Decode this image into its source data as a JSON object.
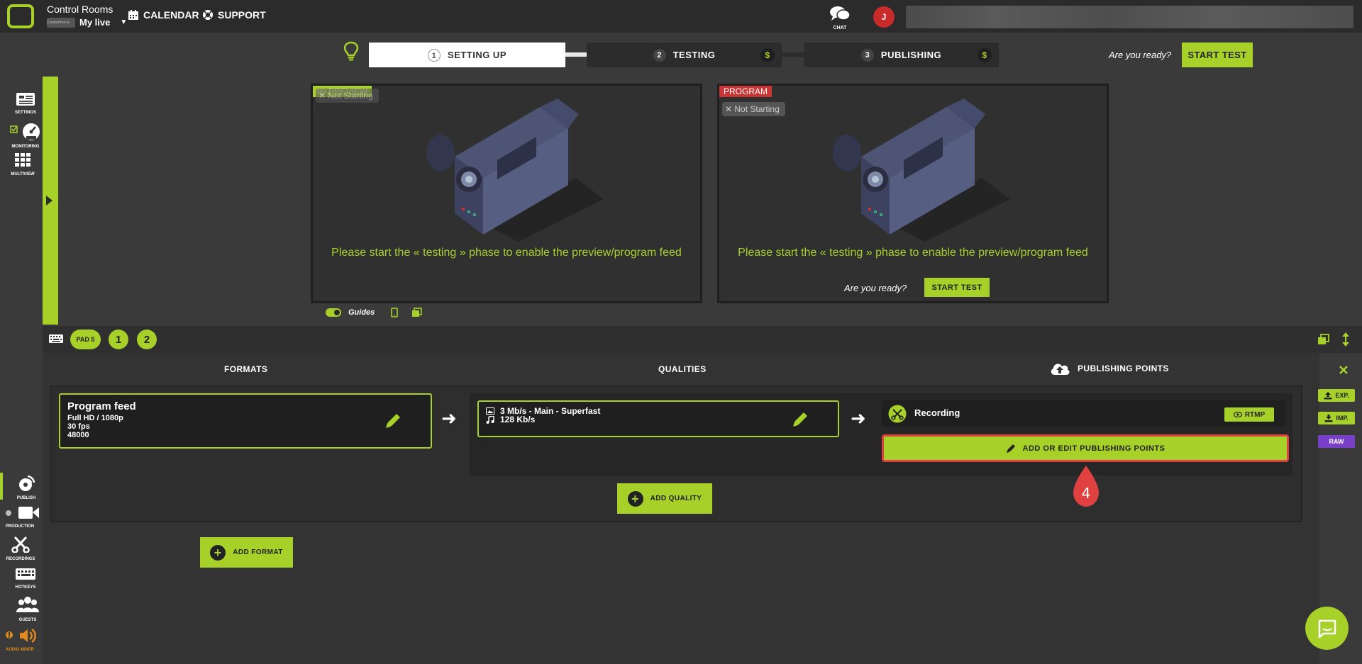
{
  "header": {
    "room_title": "Control Rooms",
    "room_name": "My live",
    "room_thumb_text": "Creatorline.io",
    "nav": [
      {
        "label": "CALENDAR",
        "icon": "calendar-icon"
      },
      {
        "label": "SUPPORT",
        "icon": "lifebuoy-icon"
      }
    ],
    "chat_label": "CHAT",
    "avatar_initial": "J"
  },
  "stepper": {
    "steps": [
      {
        "num": "1",
        "label": "SETTING UP",
        "active": true
      },
      {
        "num": "2",
        "label": "TESTING",
        "active": false,
        "badge": "$"
      },
      {
        "num": "3",
        "label": "PUBLISHING",
        "active": false,
        "badge": "$"
      }
    ],
    "ready_text": "Are you ready?",
    "start_test_label": "START TEST"
  },
  "left_nav": {
    "top": [
      {
        "label": "SETTINGS",
        "icon": "settings-icon"
      },
      {
        "label": "MONITORING",
        "icon": "gauge-icon"
      },
      {
        "label": "MULTIVIEW",
        "icon": "grid-icon"
      }
    ],
    "bottom": [
      {
        "label": "PUBLISH",
        "icon": "broadcast-icon"
      },
      {
        "label": "PRODUCTION",
        "icon": "video-camera-icon"
      },
      {
        "label": "RECORDINGS",
        "icon": "scissors-icon"
      },
      {
        "label": "HOTKEYS",
        "icon": "keyboard-icon"
      },
      {
        "label": "GUESTS",
        "icon": "users-icon"
      },
      {
        "label": "AUDIO MIXER",
        "icon": "speaker-icon"
      }
    ]
  },
  "preview": {
    "tag": "PREVIEW",
    "status": "Not Starting",
    "message": "Please start the « testing » phase to enable the preview/program feed"
  },
  "program": {
    "tag": "PROGRAM",
    "status": "Not Starting",
    "message": "Please start the « testing » phase to enable the preview/program feed",
    "ready_text": "Are you ready?",
    "start_test_label": "START TEST"
  },
  "guides": {
    "label": "Guides"
  },
  "pads": {
    "pad_label": "PAD 5",
    "pad_1": "1",
    "pad_2": "2"
  },
  "columns": {
    "formats": "FORMATS",
    "qualities": "QUALITIES",
    "publishing_points": "PUBLISHING POINTS"
  },
  "format_card": {
    "title": "Program feed",
    "resolution": "Full HD / 1080p",
    "fps": "30 fps",
    "audio": "48000"
  },
  "quality_card": {
    "video": "3 Mb/s  -  Main  -  Superfast",
    "audio": "128 Kb/s"
  },
  "publishing_point": {
    "name": "Recording",
    "protocol_label": "RTMP"
  },
  "buttons": {
    "add_edit_publishing": "ADD OR EDIT PUBLISHING POINTS",
    "add_quality": "ADD QUALITY",
    "add_format": "ADD FORMAT",
    "exp": "EXP.",
    "imp": "IMP.",
    "raw": "RAW"
  },
  "annotation": {
    "marker_number": "4"
  },
  "colors": {
    "accent": "#a7d129",
    "program_tag": "#c93535",
    "highlight_border": "#e04040",
    "raw_button": "#7a3fc8"
  }
}
